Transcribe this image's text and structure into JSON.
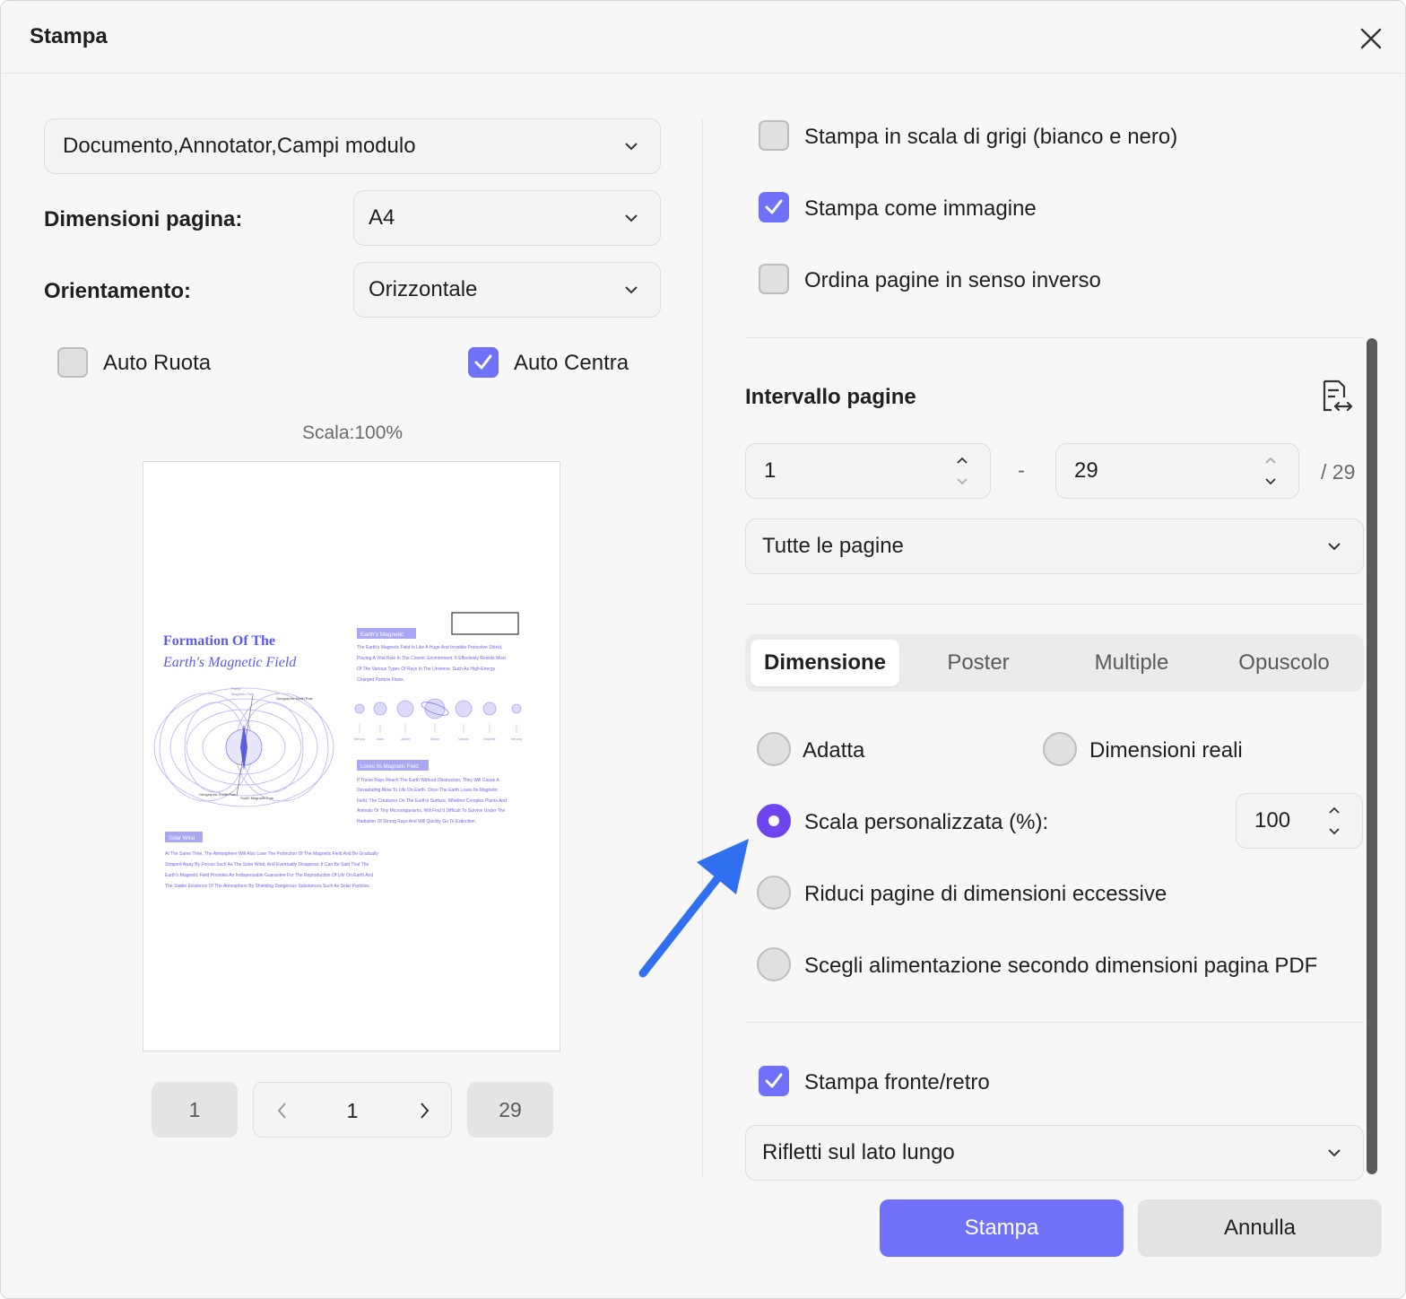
{
  "dialog": {
    "title": "Stampa"
  },
  "left": {
    "content_select": "Documento,Annotator,Campi modulo",
    "page_size_label": "Dimensioni pagina:",
    "page_size_value": "A4",
    "orientation_label": "Orientamento:",
    "orientation_value": "Orizzontale",
    "auto_rotate": {
      "label": "Auto Ruota",
      "checked": false
    },
    "auto_center": {
      "label": "Auto Centra",
      "checked": true
    },
    "scale_label": "Scala:100%",
    "preview": {
      "title_line1": "Formation Of The",
      "title_line2": "Earth's Magnetic Field",
      "tag1": "Earth's Magnetic",
      "para1": [
        "The Earth's Magnetic Field Is Like A Huge And Invisible Protective Shield,",
        "Playing A Vital Role In The Cosmic Environment. It Effectively Resists Most",
        "Of The Various Types Of Rays In The Universe, Such As High-Energy",
        "Charged Particle Flows."
      ],
      "planets": [
        "Mercury",
        "Mars",
        "Jupiter",
        "Saturn",
        "Uranus",
        "Neptune",
        "Mercury"
      ],
      "tag2": "Loses Its Magnetic Field",
      "para2": [
        "If These Rays Reach The Earth Without Obstruction, They Will Cause A",
        "Devastating Blow To Life On Earth. Once The Earth Loses Its Magnetic",
        "Field, The Creatures On The Earth's Surface, Whether Complex Plants And",
        "Animals Or Tiny Microorganisms, Will Find It Difficult To Survive Under The",
        "Radiation Of Strong Rays And Will Quickly Go To Extinction."
      ],
      "tag3": "Solar Wind",
      "para3": [
        "At The Same Time, The Atmosphere Will Also Lose The Protection Of The Magnetic Field And Be Gradually",
        "Stripped Away By Forces Such As The Solar Wind, And Eventually Disappear. It Can Be Said That The",
        "Earth's Magnetic Field Provides An Indispensable Guarantee For The Reproduction Of Life On Earth And",
        "The Stable Existence Of The Atmosphere By Shielding Dangerous Substances Such As Solar Particles."
      ],
      "diagram_labels": {
        "partly": "Partly",
        "magnetic_pole": "Magnetic Pole",
        "geo_north": "Geographic North Pole",
        "geo_south": "Geographic South Pole",
        "south_magnetic": "South Magnetic Pole"
      }
    },
    "pager": {
      "first": "1",
      "current": "1",
      "last": "29"
    }
  },
  "right": {
    "grayscale": {
      "label": "Stampa in scala di grigi (bianco e nero)",
      "checked": false
    },
    "as_image": {
      "label": "Stampa come immagine",
      "checked": true
    },
    "reverse": {
      "label": "Ordina pagine in senso inverso",
      "checked": false
    },
    "range_title": "Intervallo pagine",
    "range_from": "1",
    "range_dash": "-",
    "range_to": "29",
    "range_total": "/ 29",
    "range_select": "Tutte le pagine",
    "tabs": [
      "Dimensione",
      "Poster",
      "Multiple",
      "Opuscolo"
    ],
    "active_tab": "Dimensione",
    "radios": {
      "fit": "Adatta",
      "actual": "Dimensioni reali",
      "custom": "Scala personalizzata (%):",
      "shrink": "Riduci pagine di dimensioni eccessive",
      "paper_source": "Scegli alimentazione secondo dimensioni pagina PDF"
    },
    "selected_radio": "custom",
    "custom_scale_value": "100",
    "duplex": {
      "label": "Stampa fronte/retro",
      "checked": true
    },
    "duplex_select": "Rifletti sul lato lungo"
  },
  "buttons": {
    "print": "Stampa",
    "cancel": "Annulla"
  },
  "colors": {
    "accent": "#6f72f8",
    "radio_accent": "#6f45f0",
    "annotation_arrow": "#2f6ff0",
    "preview_text": "#5b5bf0"
  }
}
